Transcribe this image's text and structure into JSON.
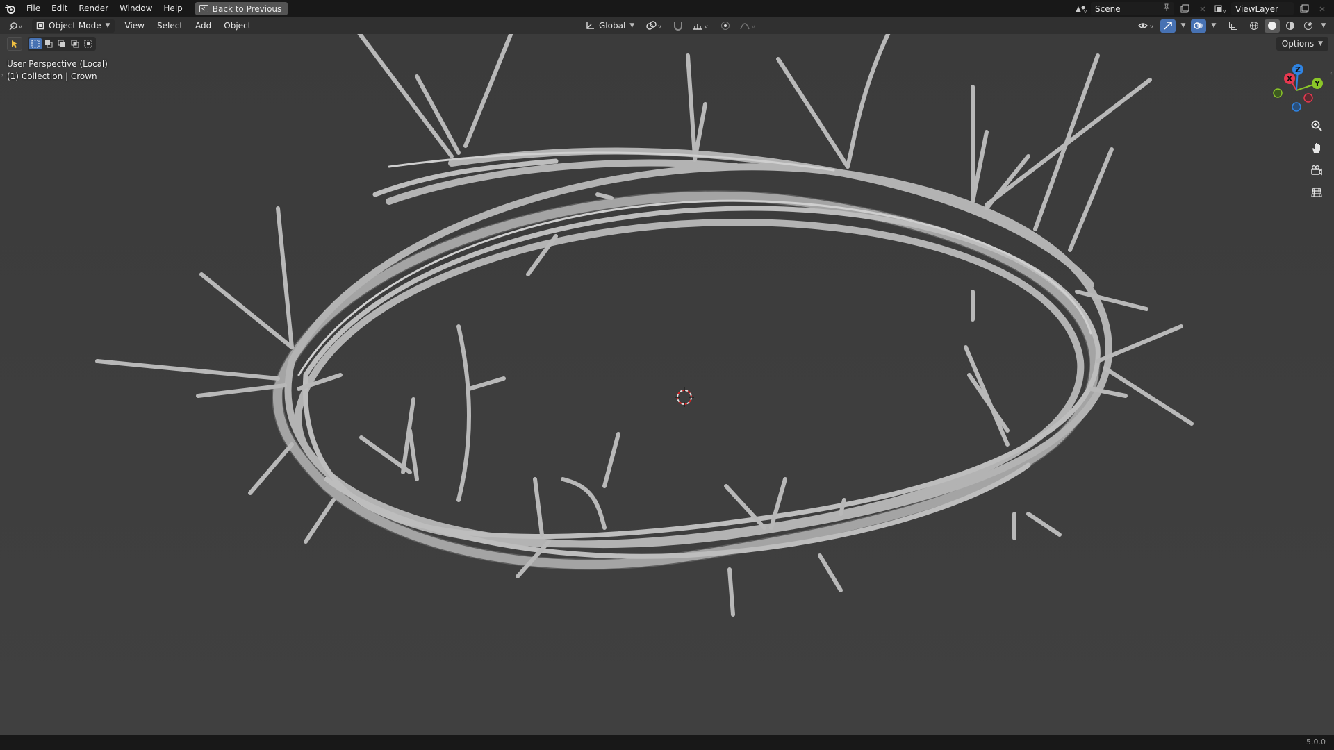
{
  "topbar": {
    "menus": [
      {
        "id": "file",
        "label": "File"
      },
      {
        "id": "edit",
        "label": "Edit"
      },
      {
        "id": "render",
        "label": "Render"
      },
      {
        "id": "window",
        "label": "Window"
      },
      {
        "id": "help",
        "label": "Help"
      }
    ],
    "back_label": "Back to Previous",
    "scene_label": "Scene",
    "viewlayer_label": "ViewLayer"
  },
  "header": {
    "mode_label": "Object Mode",
    "menus": [
      {
        "id": "view",
        "label": "View"
      },
      {
        "id": "select",
        "label": "Select"
      },
      {
        "id": "add",
        "label": "Add"
      },
      {
        "id": "object",
        "label": "Object"
      }
    ],
    "transform_orientation": "Global",
    "options_label": "Options"
  },
  "viewport": {
    "perspective_label": "User Perspective (Local)",
    "collection_label": "(1) Collection | Crown",
    "gizmo": {
      "x_label": "X",
      "y_label": "Y",
      "z_label": "Z"
    }
  },
  "status": {
    "version": "5.0.0"
  },
  "colors": {
    "accent": "#4772b3",
    "axis_x": "#e8384f",
    "axis_y": "#8bc628",
    "axis_z": "#2f84e3",
    "background": "#3d3d3d"
  }
}
